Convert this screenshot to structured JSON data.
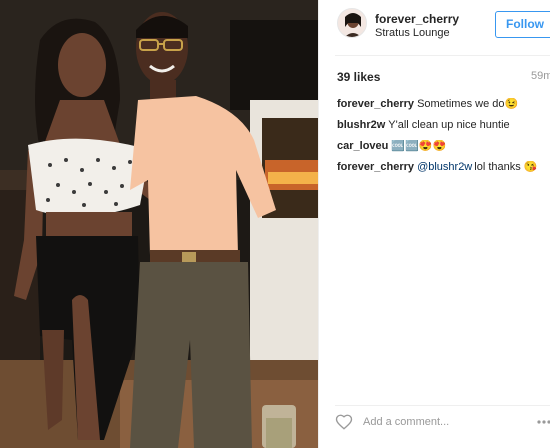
{
  "post": {
    "username": "forever_cherry",
    "location": "Stratus Lounge",
    "follow_label": "Follow",
    "likes": "39 likes",
    "time": "59m"
  },
  "comments": [
    {
      "author": "forever_cherry",
      "mention": "",
      "text": "Sometimes we do😉"
    },
    {
      "author": "blushr2w",
      "mention": "",
      "text": "Y'all clean up nice huntie"
    },
    {
      "author": "car_loveu",
      "mention": "",
      "text": "🆒🆒😍😍"
    },
    {
      "author": "forever_cherry",
      "mention": "@blushr2w",
      "text": "lol thanks 😘"
    }
  ],
  "footer": {
    "add_comment_placeholder": "Add a comment..."
  },
  "icons": {
    "like": "heart-outline-icon",
    "more": "more-options-icon"
  },
  "colors": {
    "follow_blue": "#3897f0",
    "mention_blue": "#003569",
    "muted_gray": "#999999"
  }
}
